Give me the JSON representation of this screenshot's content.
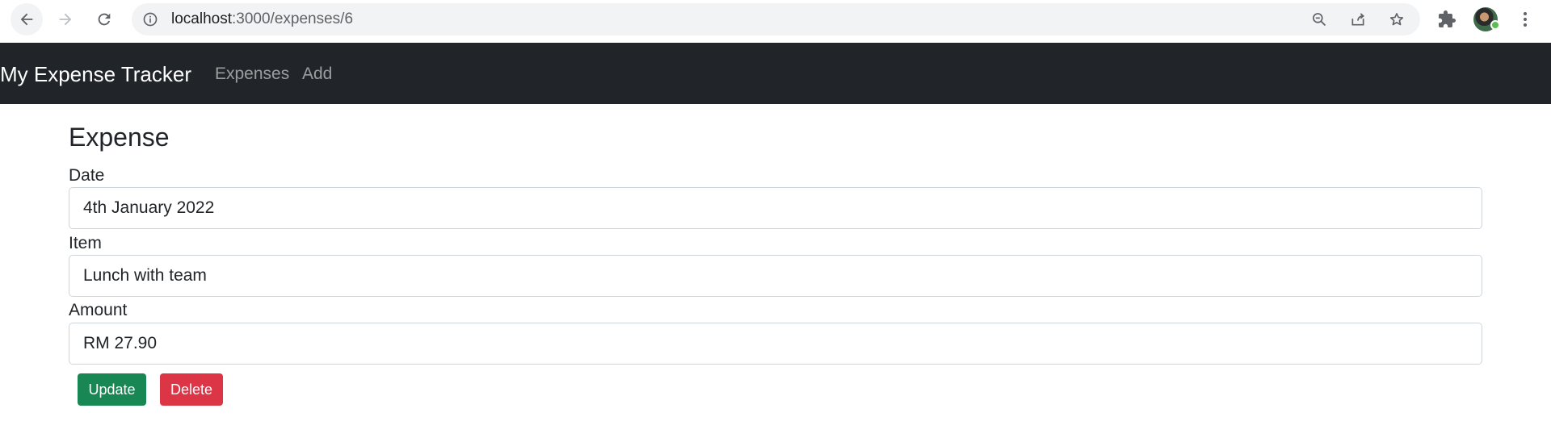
{
  "browser": {
    "url_host": "localhost",
    "url_path": ":3000/expenses/6",
    "icons": {
      "back": "arrow-left-icon",
      "forward": "arrow-right-icon",
      "reload": "reload-icon",
      "info": "info-icon",
      "zoom": "zoom-out-icon",
      "share": "share-icon",
      "bookmark": "star-icon",
      "extensions": "puzzle-icon",
      "menu": "more-vert-icon"
    }
  },
  "navbar": {
    "brand": "My Expense Tracker",
    "links": [
      {
        "label": "Expenses"
      },
      {
        "label": "Add"
      }
    ],
    "background": "#212529"
  },
  "form": {
    "title": "Expense",
    "date": {
      "label": "Date",
      "value": "4th January 2022"
    },
    "item": {
      "label": "Item",
      "value": "Lunch with team"
    },
    "amount": {
      "label": "Amount",
      "value": "RM 27.90"
    },
    "buttons": {
      "update": {
        "label": "Update",
        "color": "#198754"
      },
      "delete": {
        "label": "Delete",
        "color": "#dc3545"
      }
    }
  }
}
